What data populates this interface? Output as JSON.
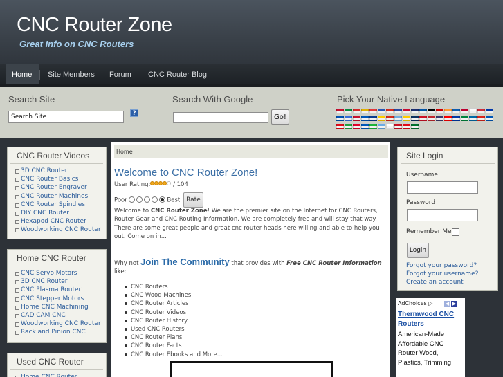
{
  "header": {
    "title": "CNC Router Zone",
    "slogan": "Great Info on CNC Routers"
  },
  "nav": {
    "items": [
      {
        "label": "Home",
        "active": true
      },
      {
        "label": "Site Members"
      },
      {
        "label": "Forum"
      },
      {
        "label": "CNC Router Blog"
      }
    ]
  },
  "search": {
    "title": "Search Site",
    "value": "Search Site",
    "help_icon": "question-icon"
  },
  "google": {
    "title": "Search With Google",
    "button": "Go!"
  },
  "language": {
    "title": "Pick Your Native Language",
    "flag_colors": [
      "#c8102e",
      "#0b8a3e",
      "#d62828",
      "#e0b100",
      "#e23a3a",
      "#2456b5",
      "#d52b1e",
      "#2a4aa1",
      "#c60c30",
      "#1a2e6e",
      "#0055a4",
      "#000000",
      "#d00000",
      "#ff9933",
      "#0d5eaf",
      "#bc002d",
      "#fafafa",
      "#cd2e3a",
      "#0038a8",
      "#0052b4",
      "#3a6fd8",
      "#c8102e",
      "#0057b8",
      "#0a3d91",
      "#ffcc00",
      "#d52b1e",
      "#74acdf",
      "#ffcd00",
      "#0a3161",
      "#ce1126",
      "#c1272d",
      "#3c3b6e",
      "#ff0000",
      "#0039a6",
      "#00843d",
      "#006aa7",
      "#da251d",
      "#0057b7",
      "#e30a17",
      "#239f40",
      "#e4002b",
      "#005bbb",
      "#1eb53a",
      "#6cace4",
      "#ffffff",
      "#ce1126",
      "#e30a17",
      "#00732f"
    ]
  },
  "videos_box": {
    "title": "CNC Router Videos",
    "items": [
      "3D CNC Router",
      "CNC Router Basics",
      "CNC Router Engraver",
      "CNC Router Machines",
      "CNC Router Spindles",
      "DIY CNC Router",
      "Hexapod CNC Router",
      "Woodworking CNC Router"
    ]
  },
  "home_box": {
    "title": "Home CNC Router",
    "items": [
      "CNC Servo Motors",
      "3D CNC Router",
      "CNC Plasma Router",
      "CNC Stepper Motors",
      "Home CNC Machining",
      "CAD CAM CNC",
      "Woodworking CNC Router",
      "Rack and Pinion CNC"
    ]
  },
  "used_box": {
    "title": "Used CNC Router",
    "items": [
      "Home CNC Router"
    ]
  },
  "content": {
    "breadcrumb": "Home",
    "title": "Welcome to CNC Router Zone!",
    "rating_label": "User Rating:",
    "rating_count": "/ 104",
    "rating_value": 4,
    "rating_max": 5,
    "poor_label": "Poor",
    "best_label": "Best",
    "rate_button": "Rate",
    "intro_pre": "Welcome to ",
    "intro_bold": "CNC Router Zone",
    "intro_post": "! We are the premier site on the Internet for CNC Routers, Router Gear and CNC Routing Information. We are completely free and will stay that way. There are some great people and great cnc router heads here willing and able to help you out. Come on in...",
    "join_pre": "Why not ",
    "join_link": "Join The Community",
    "join_mid": " that provides with ",
    "join_em": "Free CNC Router Information",
    "join_post": " like:",
    "join_items": [
      "CNC Routers",
      "CNC Wood Machines",
      "CNC Router Articles",
      "CNC Router Videos",
      "CNC Router History",
      "Used CNC Routers",
      "CNC Router Plans",
      "CNC Router Facts",
      "CNC Router Ebooks and More..."
    ]
  },
  "login": {
    "title": "Site Login",
    "username_label": "Username",
    "password_label": "Password",
    "remember_label": "Remember Me",
    "login_button": "Login",
    "forgot_password": "Forgot your password?",
    "forgot_username": "Forgot your username?",
    "create_account": "Create an account"
  },
  "ad": {
    "choices_label": "AdChoices",
    "link": "Thermwood CNC Routers",
    "text": "American-Made Affordable CNC Router Wood, Plastics, Trimming,"
  }
}
